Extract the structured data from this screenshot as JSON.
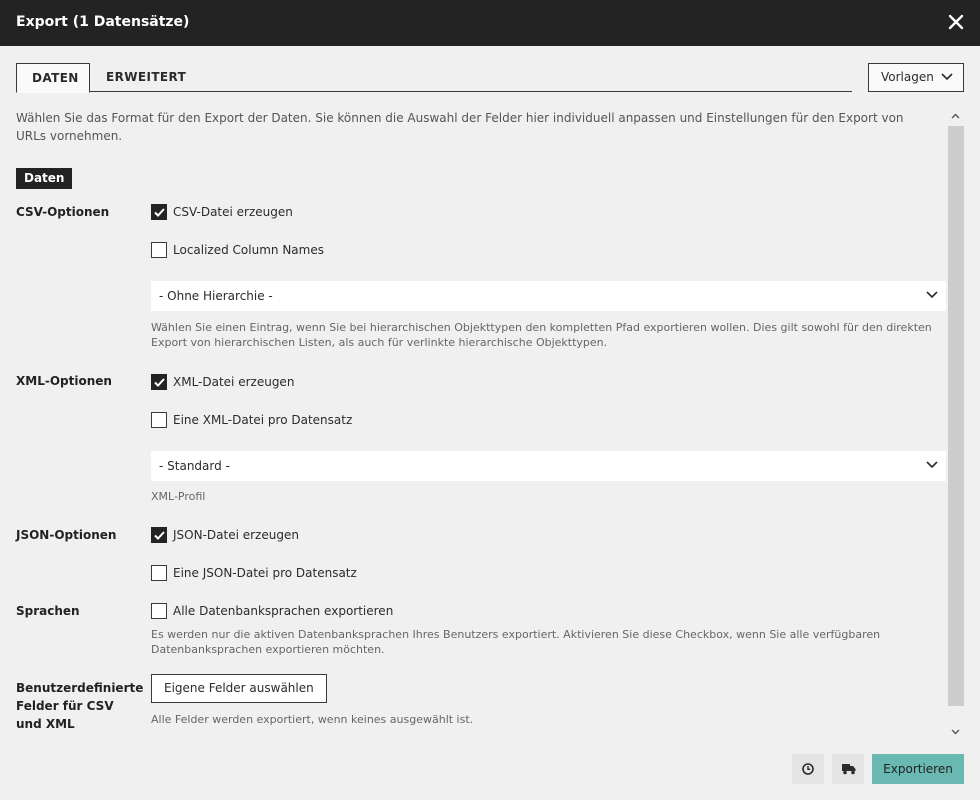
{
  "dialog": {
    "title": "Export (1 Datensätze)",
    "close_icon": "close-icon"
  },
  "tabs": [
    {
      "label": "DATEN",
      "active": true
    },
    {
      "label": "ERWEITERT",
      "active": false
    }
  ],
  "templates": {
    "label": "Vorlagen",
    "icon": "chevron-down-icon"
  },
  "intro": "Wählen Sie das Format für den Export der Daten. Sie können die Auswahl der Felder hier individuell anpassen und Einstellungen für den Export von URLs vornehmen.",
  "section": "Daten",
  "csv": {
    "label": "CSV-Optionen",
    "checkbox_create": {
      "label": "CSV-Datei erzeugen",
      "checked": true
    },
    "checkbox_localized": {
      "label": "Localized Column Names",
      "checked": false
    },
    "hierarchy_select": "- Ohne Hierarchie -",
    "hierarchy_hint": "Wählen Sie einen Eintrag, wenn Sie bei hierarchischen Objekttypen den kompletten Pfad exportieren wollen. Dies gilt sowohl für den direkten Export von hierarchischen Listen, als auch für verlinkte hierarchische Objekttypen."
  },
  "xml": {
    "label": "XML-Optionen",
    "checkbox_create": {
      "label": "XML-Datei erzeugen",
      "checked": true
    },
    "checkbox_per_record": {
      "label": "Eine XML-Datei pro Datensatz",
      "checked": false
    },
    "profile_select": "- Standard -",
    "profile_hint": "XML-Profil"
  },
  "json": {
    "label": "JSON-Optionen",
    "checkbox_create": {
      "label": "JSON-Datei erzeugen",
      "checked": true
    },
    "checkbox_per_record": {
      "label": "Eine JSON-Datei pro Datensatz",
      "checked": false
    }
  },
  "languages": {
    "label": "Sprachen",
    "checkbox_all": {
      "label": "Alle Datenbanksprachen exportieren",
      "checked": false
    },
    "hint": "Es werden nur die aktiven Datenbanksprachen Ihres Benutzers exportiert. Aktivieren Sie diese Checkbox, wenn Sie alle verfügbaren Datenbanksprachen exportieren möchten."
  },
  "custom_fields": {
    "label": "Benutzerdefinierte Felder für CSV und XML",
    "button": "Eigene Felder auswählen",
    "hint": "Alle Felder werden exportiert, wenn keines ausgewählt ist."
  },
  "footer": {
    "history_icon": "clock-icon",
    "truck_icon": "truck-icon",
    "export_label": "Exportieren",
    "export_color": "#6ab8b2"
  }
}
